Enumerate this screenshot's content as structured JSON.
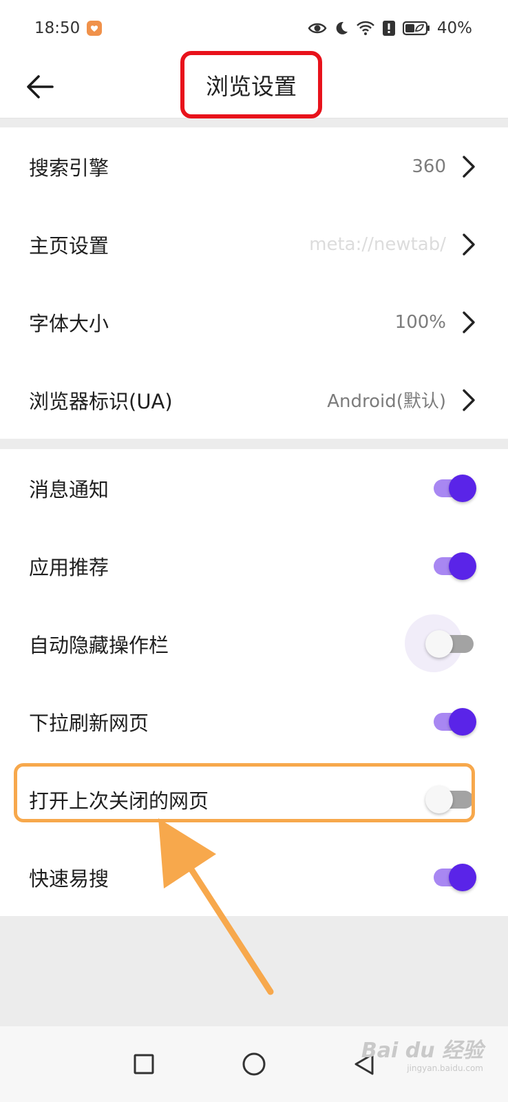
{
  "status_bar": {
    "time": "18:50",
    "battery_percent": "40%",
    "icons": [
      "app-badge-icon",
      "eye-icon",
      "moon-icon",
      "wifi-icon",
      "alert-icon",
      "battery-icon"
    ]
  },
  "header": {
    "back_icon": "arrow-left-icon",
    "title": "浏览设置"
  },
  "groups": [
    {
      "rows": [
        {
          "label": "搜索引擎",
          "value": "360"
        },
        {
          "label": "主页设置",
          "value": "meta://newtab/"
        },
        {
          "label": "字体大小",
          "value": "100%"
        },
        {
          "label": "浏览器标识(UA)",
          "value": "Android(默认)"
        }
      ]
    },
    {
      "rows": [
        {
          "label": "消息通知",
          "toggle": "on"
        },
        {
          "label": "应用推荐",
          "toggle": "on"
        },
        {
          "label": "自动隐藏操作栏",
          "toggle": "off"
        },
        {
          "label": "下拉刷新网页",
          "toggle": "on"
        },
        {
          "label": "打开上次关闭的网页",
          "toggle": "off"
        },
        {
          "label": "快速易搜",
          "toggle": "on"
        }
      ]
    }
  ],
  "colors": {
    "accent": "#5a24e8",
    "accent_track": "#a887f2",
    "title_highlight": "#e8121b",
    "row_highlight": "#f7a84c"
  },
  "navbar": {
    "icons": [
      "square-icon",
      "circle-icon",
      "triangle-back-icon"
    ]
  },
  "watermark": {
    "text": "Bai du 经验",
    "sub": "jingyan.baidu.com"
  }
}
